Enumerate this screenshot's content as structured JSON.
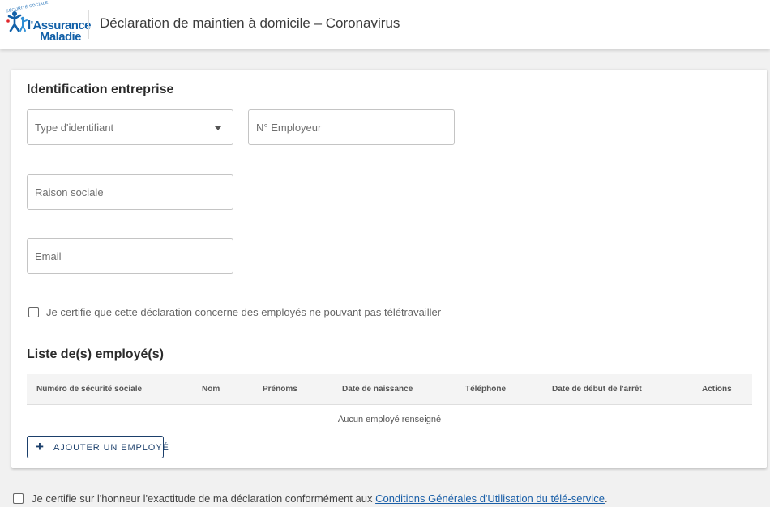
{
  "header": {
    "logo": {
      "top_text": "SÉCURITÉ SOCIALE",
      "line1": "l'Assurance",
      "line2": "Maladie",
      "brand_color": "#1260a8",
      "icon": "family-emblem-icon"
    },
    "title": "Déclaration de maintien à domicile – Coronavirus"
  },
  "identification": {
    "title": "Identification entreprise",
    "type_identifiant": {
      "placeholder": "Type d'identifiant",
      "icon": "caret-down-icon"
    },
    "numero_employeur": {
      "placeholder": "N° Employeur"
    },
    "raison_sociale": {
      "placeholder": "Raison sociale"
    },
    "email": {
      "placeholder": "Email"
    },
    "teletravail_checkbox": {
      "label": "Je certifie que cette déclaration concerne des employés ne pouvant pas télétravailler",
      "checked": false
    }
  },
  "employees": {
    "title": "Liste de(s) employé(s)",
    "columns": [
      "Numéro de sécurité sociale",
      "Nom",
      "Prénoms",
      "Date de naissance",
      "Téléphone",
      "Date de début de l'arrêt",
      "Actions"
    ],
    "empty_text": "Aucun employé renseigné",
    "add_button": {
      "label": "AJOUTER UN EMPLOYÉ",
      "icon": "plus-icon"
    }
  },
  "footer": {
    "certify_text": "Je certifie sur l'honneur l'exactitude de ma déclaration conformément aux ",
    "link_text": "Conditions Générales d'Utilisation du télé-service",
    "suffix": ".",
    "checked": false
  },
  "colors": {
    "accent": "#1b3f6b",
    "link": "#1a5fa8",
    "background": "#f1f1f1"
  }
}
